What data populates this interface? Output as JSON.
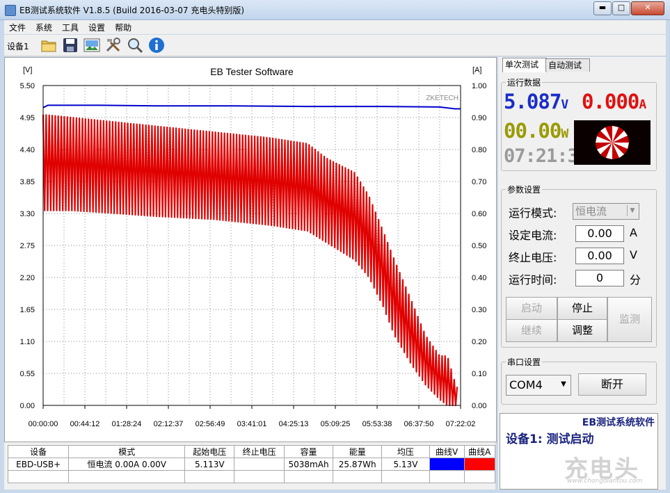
{
  "window": {
    "title": "EB测试系统软件 V1.8.5 (Build 2016-03-07 充电头特别版)",
    "min_label": "▬",
    "max_label": "□",
    "close_label": "✕"
  },
  "menu": [
    "文件",
    "系统",
    "工具",
    "设置",
    "帮助"
  ],
  "toolbar": {
    "device_label": "设备1",
    "icons": [
      "folder-icon",
      "save-icon",
      "image-icon",
      "tools-icon",
      "search-icon",
      "info-icon"
    ]
  },
  "chart_data": {
    "type": "line",
    "title": "EB Tester Software",
    "y_left_unit": "[V]",
    "y_right_unit": "[A]",
    "watermark": "ZKETECH",
    "y_left_ticks": [
      "5.50",
      "4.95",
      "4.40",
      "3.85",
      "3.30",
      "2.75",
      "2.20",
      "1.65",
      "1.10",
      "0.55",
      "0.00"
    ],
    "y_right_ticks": [
      "1.00",
      "0.90",
      "0.80",
      "0.70",
      "0.60",
      "0.50",
      "0.40",
      "0.30",
      "0.20",
      "0.10",
      "0.00"
    ],
    "x_ticks": [
      "00:00:00",
      "00:44:12",
      "01:28:24",
      "02:12:37",
      "02:56:49",
      "03:41:01",
      "04:25:13",
      "05:09:25",
      "05:53:38",
      "06:37:50",
      "07:22:02"
    ],
    "ylim_left": [
      0,
      5.5
    ],
    "ylim_right": [
      0,
      1.0
    ],
    "grid": true,
    "series": [
      {
        "axis": "left",
        "color": "#0000cc",
        "x_minutes": [
          0,
          5,
          60,
          120,
          200,
          280,
          360,
          420,
          436,
          442
        ],
        "values": [
          5.12,
          5.16,
          5.16,
          5.15,
          5.15,
          5.14,
          5.14,
          5.13,
          5.1,
          5.1
        ]
      },
      {
        "axis": "left",
        "color": "#e00000",
        "band_x_minutes": [
          0,
          30,
          60,
          120,
          180,
          240,
          280,
          300,
          330,
          345,
          360,
          372,
          390,
          405,
          420,
          428,
          436,
          439
        ],
        "band_high": [
          5.0,
          4.95,
          4.9,
          4.8,
          4.7,
          4.6,
          4.5,
          4.25,
          4.0,
          3.6,
          3.0,
          2.5,
          1.8,
          1.2,
          0.85,
          0.85,
          0.4,
          0.3
        ],
        "band_low": [
          3.35,
          3.35,
          3.32,
          3.25,
          3.2,
          3.1,
          3.0,
          2.8,
          2.5,
          2.2,
          1.7,
          1.2,
          0.7,
          0.35,
          0.1,
          0.0,
          0.0,
          0.0
        ]
      }
    ]
  },
  "stats": {
    "headers": [
      "设备",
      "模式",
      "起始电压",
      "终止电压",
      "容量",
      "能量",
      "均压",
      "曲线V",
      "曲线A"
    ],
    "row": [
      "EBD-USB+",
      "恒电流  0.00A  0.00V",
      "5.113V",
      "",
      "5038mAh",
      "25.87Wh",
      "5.13V"
    ],
    "curve_v_color": "#0000ff",
    "curve_a_color": "#ff0000"
  },
  "right": {
    "tabs": [
      "单次测试",
      "自动测试"
    ],
    "run_data": {
      "legend": "运行数据",
      "voltage": "5.087",
      "voltage_unit": "V",
      "current": "0.000",
      "current_unit": "A",
      "power": "00.00",
      "power_unit": "W",
      "time": "07:21:38",
      "voltage_color": "#1a2dc8",
      "current_color": "#e01010",
      "power_color": "#9a9a00"
    },
    "params": {
      "legend": "参数设置",
      "mode_label": "运行模式:",
      "mode_value": "恒电流",
      "current_label": "设定电流:",
      "current_value": "0.00",
      "current_unit": "A",
      "voltage_label": "终止电压:",
      "voltage_value": "0.00",
      "voltage_unit": "V",
      "time_label": "运行时间:",
      "time_value": "0",
      "time_unit": "分",
      "btn_start": "启动",
      "btn_stop": "停止",
      "btn_continue": "继续",
      "btn_adjust": "调整",
      "btn_monitor": "监测"
    },
    "serial": {
      "legend": "串口设置",
      "port": "COM4",
      "disconnect": "断开"
    },
    "status": {
      "title": "EB测试系统软件",
      "message": "设备1: 测试启动"
    },
    "watermark_text": "充电头",
    "watermark_url": "www.chongdiantou.com"
  }
}
